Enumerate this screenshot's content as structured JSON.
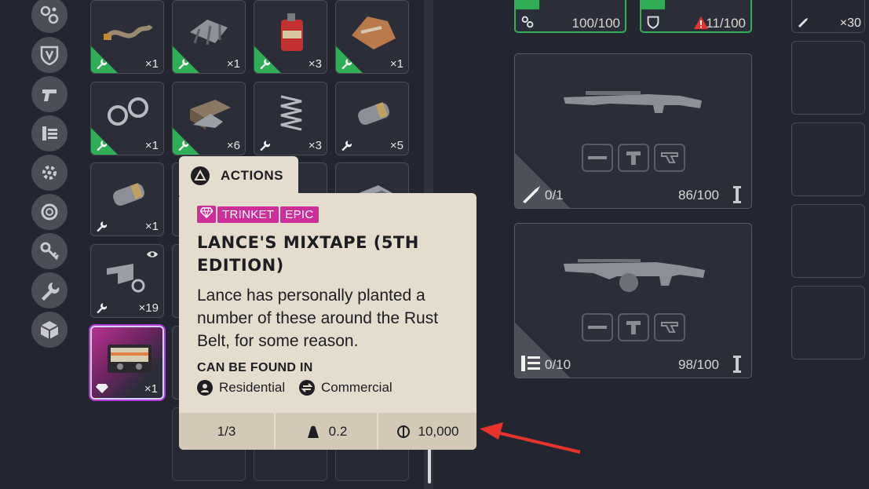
{
  "categories": [
    {
      "icon": "gear-cluster-icon"
    },
    {
      "icon": "shield-icon"
    },
    {
      "icon": "pistol-icon"
    },
    {
      "icon": "ammo-icon"
    },
    {
      "icon": "attachment-gear-icon"
    },
    {
      "icon": "ring-icon"
    },
    {
      "icon": "key-icon"
    },
    {
      "icon": "wrench-icon"
    },
    {
      "icon": "cube-icon"
    }
  ],
  "grid": {
    "items": [
      {
        "qty": "×1",
        "rarity": "uncommon",
        "art": "hose"
      },
      {
        "qty": "×1",
        "rarity": "uncommon",
        "art": "scrap"
      },
      {
        "qty": "×3",
        "rarity": "uncommon",
        "art": "canister"
      },
      {
        "qty": "×1",
        "rarity": "uncommon",
        "art": "rags"
      },
      {
        "qty": "×1",
        "rarity": "uncommon",
        "art": "handcuffs"
      },
      {
        "qty": "×6",
        "rarity": "uncommon",
        "art": "plates"
      },
      {
        "qty": "×3",
        "rarity": "none",
        "art": "spring"
      },
      {
        "qty": "×5",
        "rarity": "none",
        "art": "cylinder"
      },
      {
        "qty": "×1",
        "rarity": "none",
        "art": "cylinder"
      },
      {
        "qty": "×19",
        "rarity": "none",
        "art": "brackets"
      },
      {
        "qty": "×1",
        "rarity": "epic",
        "art": "cassette"
      }
    ]
  },
  "weapons": {
    "top_row": [
      {
        "value": "100/100"
      },
      {
        "value": "11/100",
        "warning": true
      }
    ],
    "right_top": {
      "qty": "×30"
    },
    "panels": [
      {
        "ammo": "0/1",
        "durability": "86/100"
      },
      {
        "ammo": "0/10",
        "durability": "98/100"
      }
    ]
  },
  "tooltip": {
    "actions_label": "ACTIONS",
    "tags": [
      "TRINKET",
      "EPIC"
    ],
    "title": "LANCE'S MIXTAPE (5TH EDITION)",
    "description": "Lance has personally planted a number of these around the Rust Belt, for some reason.",
    "found_heading": "CAN BE FOUND IN",
    "locations": [
      "Residential",
      "Commercial"
    ],
    "stack": "1/3",
    "weight": "0.2",
    "value": "10,000"
  },
  "colors": {
    "background": "#232531",
    "uncommon": "#2fae55",
    "epic": "#cc2f9a",
    "tooltip_bg": "#e4dccd",
    "arrow": "#e8332b"
  }
}
